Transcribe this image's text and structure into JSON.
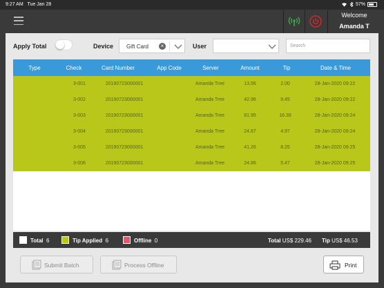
{
  "status_bar": {
    "time": "9:27 AM",
    "date": "Tue Jan 28",
    "battery": "57%",
    "battery_level": 0.57
  },
  "header": {
    "welcome": "Welcome",
    "user_name": "Amanda T",
    "wifi_status_color": "#3bb54a",
    "power_color": "#d9262c"
  },
  "filters": {
    "apply_total_label": "Apply Total",
    "apply_total_on": false,
    "device_label": "Device",
    "device_value": "Gift Card",
    "user_label": "User",
    "user_value": "",
    "search_placeholder": "Search"
  },
  "table": {
    "columns": [
      "Type",
      "Check",
      "Card Number",
      "App Code",
      "Server",
      "Amount",
      "Tip",
      "Date & Time"
    ],
    "rows": [
      {
        "type": "",
        "check": "3-001",
        "card_number": "20190723000001",
        "app_code": "",
        "server": "Amanda Tree",
        "amount": "13.56",
        "tip": "2.00",
        "datetime": "28-Jan-2020 09:22"
      },
      {
        "type": "",
        "check": "3-002",
        "card_number": "20190723000001",
        "app_code": "",
        "server": "Amanda Tree",
        "amount": "42.96",
        "tip": "9.45",
        "datetime": "28-Jan-2020 09:22"
      },
      {
        "type": "",
        "check": "3-003",
        "card_number": "20190723000001",
        "app_code": "",
        "server": "Amanda Tree",
        "amount": "81.95",
        "tip": "16.39",
        "datetime": "28-Jan-2020 09:24"
      },
      {
        "type": "",
        "check": "3-004",
        "card_number": "20190723000001",
        "app_code": "",
        "server": "Amanda Tree",
        "amount": "24.87",
        "tip": "4.97",
        "datetime": "28-Jan-2020 09:24"
      },
      {
        "type": "",
        "check": "3-005",
        "card_number": "20190723000001",
        "app_code": "",
        "server": "Amanda Tree",
        "amount": "41.26",
        "tip": "8.25",
        "datetime": "28-Jan-2020 09:25"
      },
      {
        "type": "",
        "check": "3-006",
        "card_number": "20190723000001",
        "app_code": "",
        "server": "Amanda Tree",
        "amount": "24.86",
        "tip": "5.47",
        "datetime": "28-Jan-2020 09:25"
      }
    ],
    "header_color": "#3a99d8",
    "tip_applied_row_color": "#b8c71a"
  },
  "summary": {
    "total_label": "Total",
    "total_count": "6",
    "total_color": "#ffffff",
    "tip_applied_label": "Tip Applied",
    "tip_applied_count": "6",
    "tip_applied_color": "#b8c71a",
    "offline_label": "Offline",
    "offline_count": "0",
    "offline_color": "#e8546a",
    "grand_total_label": "Total",
    "grand_total_value": "US$ 229.46",
    "tip_total_label": "Tip",
    "tip_total_value": "US$ 46.53"
  },
  "actions": {
    "submit_batch": "Submit Batch",
    "process_offline": "Process Offline",
    "print": "Print"
  }
}
